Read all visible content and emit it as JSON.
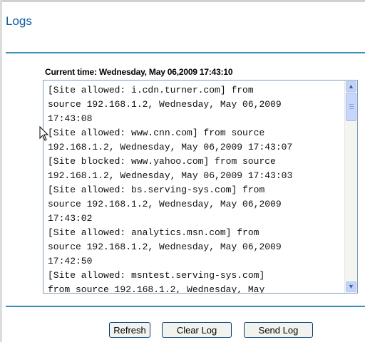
{
  "page": {
    "title": "Logs",
    "current_time": "Current time: Wednesday, May 06,2009 17:43:10"
  },
  "log": {
    "lines": [
      "[Site allowed: i.cdn.turner.com] from",
      "source 192.168.1.2, Wednesday, May 06,2009",
      "17:43:08",
      "[Site allowed: www.cnn.com] from source",
      "192.168.1.2, Wednesday, May 06,2009 17:43:07",
      "[Site blocked: www.yahoo.com] from source",
      "192.168.1.2, Wednesday, May 06,2009 17:43:03",
      "[Site allowed: bs.serving-sys.com] from",
      "source 192.168.1.2, Wednesday, May 06,2009",
      "17:43:02",
      "[Site allowed: analytics.msn.com] from",
      "source 192.168.1.2, Wednesday, May 06,2009",
      "17:42:50",
      "[Site allowed: msntest.serving-sys.com]",
      "from source 192.168.1.2, Wednesday, May"
    ],
    "scroll_position": 0.05
  },
  "buttons": {
    "refresh": "Refresh",
    "clear_log": "Clear Log",
    "send_log": "Send Log"
  },
  "icons": {
    "scroll_up": "chevron-up-icon",
    "scroll_down": "chevron-down-icon",
    "cursor": "mouse-pointer-icon"
  },
  "colors": {
    "title": "#0b5ba8",
    "rule": "#3a8fb7",
    "button_border": "#003c74"
  }
}
